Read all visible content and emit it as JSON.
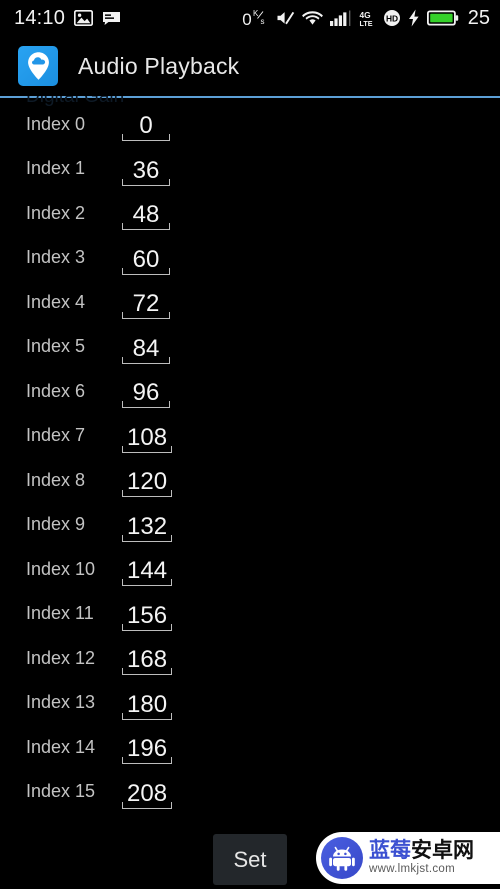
{
  "status_bar": {
    "clock": "14:10",
    "left_icons": [
      "image-icon",
      "message-icon"
    ],
    "net_speed_value": "0",
    "net_speed_unit_top": "K",
    "net_speed_unit_bottom": "s",
    "right_icons": [
      "mute-icon",
      "wifi-icon",
      "signal-bars-icon",
      "4g-lte-icon",
      "hd-icon",
      "charging-bolt-icon",
      "battery-icon"
    ],
    "signal_label_top": "4G",
    "signal_label_bottom": "LTE",
    "hd_label": "HD",
    "battery_percent": "25",
    "battery_color": "#35d12a"
  },
  "action_bar": {
    "app_icon": "cloud-pin-icon",
    "title": "Audio Playback",
    "icon_bg_color": "#1d9bf0",
    "divider_color": "#5c9fd6"
  },
  "content": {
    "section_header_partial": "Digital Gain",
    "rows": [
      {
        "label": "Index 0",
        "value": "0"
      },
      {
        "label": "Index 1",
        "value": "36"
      },
      {
        "label": "Index 2",
        "value": "48"
      },
      {
        "label": "Index 3",
        "value": "60"
      },
      {
        "label": "Index 4",
        "value": "72"
      },
      {
        "label": "Index 5",
        "value": "84"
      },
      {
        "label": "Index 6",
        "value": "96"
      },
      {
        "label": "Index 7",
        "value": "108"
      },
      {
        "label": "Index 8",
        "value": "120"
      },
      {
        "label": "Index 9",
        "value": "132"
      },
      {
        "label": "Index 10",
        "value": "144"
      },
      {
        "label": "Index 11",
        "value": "156"
      },
      {
        "label": "Index 12",
        "value": "168"
      },
      {
        "label": "Index 13",
        "value": "180"
      },
      {
        "label": "Index 14",
        "value": "196"
      },
      {
        "label": "Index 15",
        "value": "208"
      }
    ]
  },
  "bottom_bar": {
    "set_label": "Set",
    "set_bg_color": "#23272b"
  },
  "watermark": {
    "icon": "android-robot-icon",
    "name_part1": "蓝莓",
    "name_part2": "安卓网",
    "url": "www.lmkjst.com",
    "badge_color": "#4054d6",
    "accent_color": "#3b50d1"
  }
}
